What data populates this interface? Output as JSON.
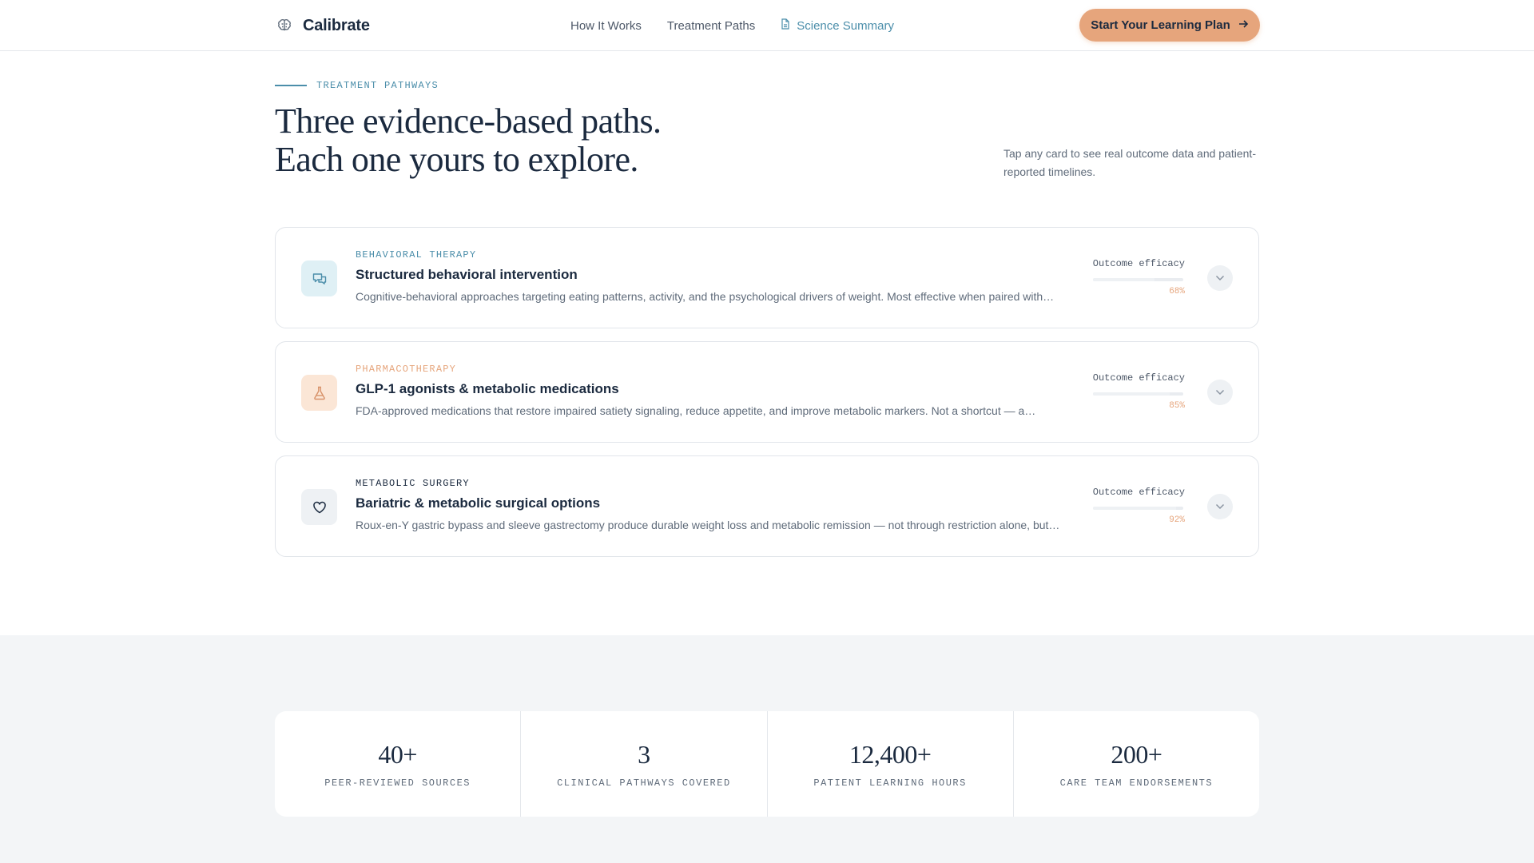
{
  "header": {
    "brand": "Calibrate",
    "nav": [
      {
        "label": "How It Works"
      },
      {
        "label": "Treatment Paths"
      },
      {
        "label": "Science Summary",
        "icon": "document-icon"
      }
    ],
    "cta_label": "Start Your Learning Plan",
    "cta_icon": "arrow-right-icon"
  },
  "intro": {
    "eyebrow": "TREATMENT PATHWAYS",
    "title_line1": "Three evidence-based paths.",
    "title_line2": "Each one yours to explore.",
    "note": "Tap any card to see real outcome data and patient-reported timelines."
  },
  "cards": [
    {
      "tag": "BEHAVIORAL THERAPY",
      "title": "Structured behavioral intervention",
      "description": "Cognitive-behavioral approaches targeting eating patterns, activity, and the psychological drivers of weight. Most effective when paired with…",
      "metric_label": "Outcome efficacy",
      "metric_value": "68%",
      "efficacy": 0.68,
      "icon": "chat-bubbles-icon",
      "tag_color": "#4b8eaa",
      "icon_bg": "#dff0f5",
      "icon_color": "#4b8eaa"
    },
    {
      "tag": "PHARMACOTHERAPY",
      "title": "GLP-1 agonists & metabolic medications",
      "description": "FDA-approved medications that restore impaired satiety signaling, reduce appetite, and improve metabolic markers. Not a shortcut — a…",
      "metric_label": "Outcome efficacy",
      "metric_value": "85%",
      "efficacy": 0.85,
      "icon": "flask-icon",
      "tag_color": "#e6a57c",
      "icon_bg": "#fbe6d6",
      "icon_color": "#d8926a"
    },
    {
      "tag": "METABOLIC SURGERY",
      "title": "Bariatric & metabolic surgical options",
      "description": "Roux-en-Y gastric bypass and sleeve gastrectomy produce durable weight loss and metabolic remission — not through restriction alone, but …",
      "metric_label": "Outcome efficacy",
      "metric_value": "92%",
      "efficacy": 0.92,
      "icon": "heart-icon",
      "tag_color": "#1b2a3f",
      "icon_bg": "#eef1f4",
      "icon_color": "#1b2a3f"
    }
  ],
  "stats": [
    {
      "value": "40+",
      "label": "PEER-REVIEWED SOURCES"
    },
    {
      "value": "3",
      "label": "CLINICAL PATHWAYS COVERED"
    },
    {
      "value": "12,400+",
      "label": "PATIENT LEARNING HOURS"
    },
    {
      "value": "200+",
      "label": "CARE TEAM ENDORSEMENTS"
    }
  ],
  "colors": {
    "accent_teal": "#4b8eaa",
    "accent_peach": "#e6a57c",
    "ink": "#1b2a3f"
  }
}
